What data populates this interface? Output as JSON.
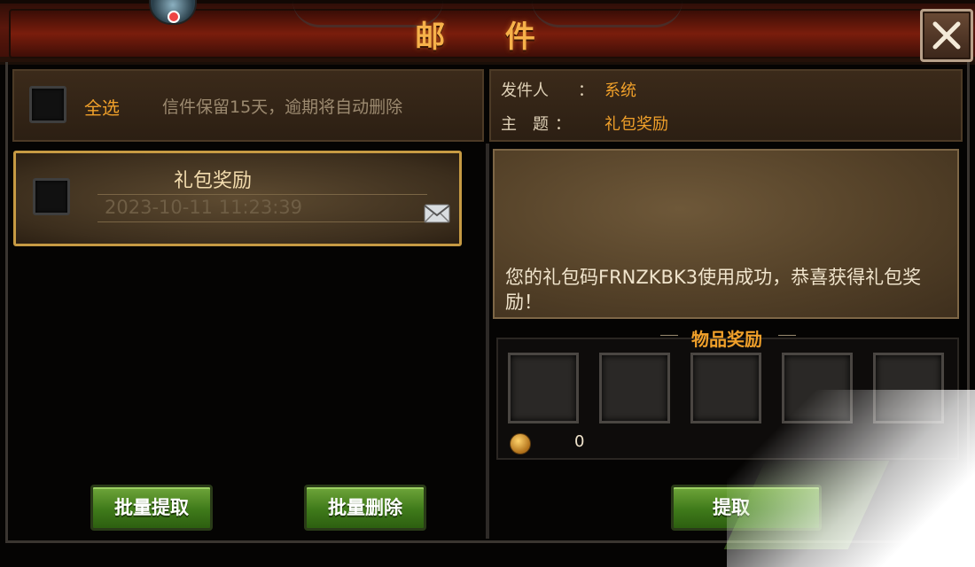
{
  "header": {
    "title": "邮 件"
  },
  "toolbar": {
    "select_all_label": "全选",
    "notice": "信件保留15天，逾期将自动删除"
  },
  "mail_list": [
    {
      "title": "礼包奖励",
      "date": "2023-10-11 11:23:39"
    }
  ],
  "detail": {
    "sender_label": "发件人",
    "sender_value": "系统",
    "subject_label": "主　题",
    "subject_value": "礼包奖励",
    "colon": "：",
    "message": "您的礼包码FRNZKBK3使用成功，恭喜获得礼包奖励！"
  },
  "rewards": {
    "header": "物品奖励",
    "coin_value": "0"
  },
  "buttons": {
    "batch_claim": "批量提取",
    "batch_delete": "批量删除",
    "claim": "提取"
  },
  "colors": {
    "accent_orange": "#f0a02a",
    "button_green": "#3f7a1a",
    "header_red": "#7a1d0c"
  }
}
